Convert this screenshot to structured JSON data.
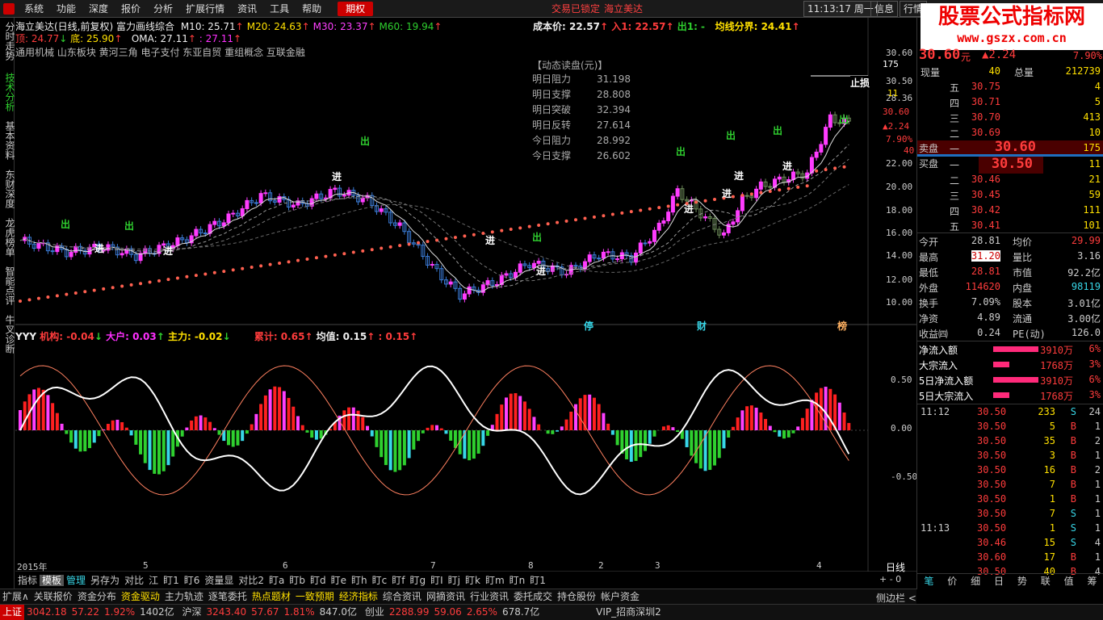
{
  "menubar": {
    "items": [
      "系统",
      "功能",
      "深度",
      "报价",
      "分析",
      "扩展行情",
      "资讯",
      "工具",
      "帮助"
    ],
    "active": "期权",
    "notice": "交易已锁定",
    "stock": "海立美达",
    "time": "11:13:17 周一",
    "info": "信息",
    "quote": "行情"
  },
  "watermark": {
    "title": "股票公式指标网",
    "url": "www.gszx.com.cn"
  },
  "sidebar": {
    "tabs": [
      "分时走势",
      "技术分析",
      "基本资料",
      "东财深度",
      "龙虎榜单",
      "智能点评",
      "牛叉诊断"
    ]
  },
  "chart": {
    "header1": "海立美达(日线,前复权) 富力画线综合",
    "ma": [
      {
        "label": "M10: 25.71",
        "arrow": "↑"
      },
      {
        "label": "M20: 24.63",
        "arrow": "↑"
      },
      {
        "label": "M30: 23.37",
        "arrow": "↑"
      },
      {
        "label": "M60: 19.94",
        "arrow": "↑"
      }
    ],
    "header2": {
      "top": "顶: 24.77",
      "top_arrow": "↓",
      "bottom": "底: 25.90",
      "bottom_arrow": "↑",
      "oma": "OMA: 27.11",
      "oma_arrow": "↑",
      "oma_val": ": 27.11",
      "oma_val_arrow": "↑"
    },
    "cost": {
      "cost": "成本价: 22.57",
      "cost_arrow": "↑",
      "in": "入1: 22.57",
      "in_arrow": "↑",
      "out": "出1: -",
      "line": "均线分界: 24.41",
      "line_arrow": "↑"
    },
    "concepts": "通用机械 山东板块 黄河三角 电子支付 东亚自贸 重组概念 互联金融",
    "dyn_title": "【动态读盘(元)】",
    "dyn": [
      {
        "k": "明日阻力",
        "v": "31.198"
      },
      {
        "k": "明日支撑",
        "v": "28.808"
      },
      {
        "k": "明日突破",
        "v": "32.394"
      },
      {
        "k": "明日反转",
        "v": "27.614"
      },
      {
        "k": "今日阻力",
        "v": "28.992"
      },
      {
        "k": "今日支撑",
        "v": "26.602"
      }
    ],
    "y_labels": [
      "30.60",
      "30.50",
      "28.36",
      "20.00",
      "22.00",
      "18.00",
      "16.00",
      "14.00",
      "12.00",
      "10.00"
    ],
    "right_labels": {
      "r1": "175",
      "r2": "11",
      "r3": "30.60",
      "r4": "▲2.24",
      "r5": "7.90%",
      "r6": "40",
      "stop": "止损"
    },
    "markers": {
      "in": "进",
      "out": "出",
      "ting": "停",
      "cai": "财",
      "bang": "榜",
      "s": "S"
    },
    "sub_header": {
      "name": "YYY",
      "jg": "机构: -0.04",
      "jg_arrow": "↓",
      "dh": "大户: 0.03",
      "dh_arrow": "↑",
      "zl": "主力: -0.02",
      "zl_arrow": "↓",
      "lj": "累计: 0.65",
      "lj_arrow": "↑",
      "jz": "均值: 0.15",
      "jz_arrow": "↑",
      "jz2": ": 0.15",
      "jz2_arrow": "↑"
    },
    "sub_y": [
      "0.50",
      "0.00",
      "-0.50"
    ],
    "x_labels": [
      "2015年",
      "5",
      "6",
      "7",
      "8",
      "2",
      "3",
      "4"
    ],
    "period": "日线",
    "zoom": "+ - 0",
    "tabs1": [
      "指标",
      "模板",
      "管理",
      "另存为",
      "对比",
      "江",
      "盯1",
      "盯6",
      "资量显",
      "对比2",
      "盯a",
      "盯b",
      "盯d",
      "盯e",
      "盯h",
      "盯c",
      "盯f",
      "盯g",
      "盯I",
      "盯j",
      "盯k",
      "盯m",
      "盯n",
      "盯1"
    ],
    "tabs2": [
      "扩展∧",
      "关联报价",
      "资金分布",
      "资金驱动",
      "主力轨迹",
      "逐笔委托",
      "热点题材",
      "一致预期",
      "经济指标",
      "综合资讯",
      "网摘资讯",
      "行业资讯",
      "委托成交",
      "持仓股份",
      "帐户资金"
    ],
    "tabs2_side": "侧边栏 <"
  },
  "quote": {
    "price": "30.60",
    "price_suffix": "元",
    "change": "▲2.24",
    "pct": "7.90%",
    "xianliang_label": "现量",
    "xianliang": "40",
    "zongliang_label": "总量",
    "zongliang": "212739",
    "sell": [
      {
        "lv": "五",
        "p": "30.75",
        "v": "4"
      },
      {
        "lv": "四",
        "p": "30.71",
        "v": "5"
      },
      {
        "lv": "三",
        "p": "30.70",
        "v": "413"
      },
      {
        "lv": "二",
        "p": "30.69",
        "v": "10"
      },
      {
        "lv": "一",
        "p": "30.60",
        "v": "175"
      }
    ],
    "buy": [
      {
        "lv": "一",
        "p": "30.50",
        "v": "11"
      },
      {
        "lv": "二",
        "p": "30.46",
        "v": "21"
      },
      {
        "lv": "三",
        "p": "30.45",
        "v": "59"
      },
      {
        "lv": "四",
        "p": "30.42",
        "v": "111"
      },
      {
        "lv": "五",
        "p": "30.41",
        "v": "101"
      }
    ],
    "sell_label": "卖盘",
    "buy_label": "买盘",
    "stats": [
      [
        "今开",
        "28.81",
        "均价",
        "29.99"
      ],
      [
        "最高",
        "31.20",
        "量比",
        "3.16"
      ],
      [
        "最低",
        "28.81",
        "市值",
        "92.2亿"
      ],
      [
        "外盘",
        "114620",
        "内盘",
        "98119"
      ],
      [
        "换手",
        "7.09%",
        "股本",
        "3.01亿"
      ],
      [
        "净资",
        "4.89",
        "流通",
        "3.00亿"
      ],
      [
        "收益㈣",
        "0.24",
        "PE(动)",
        "126.0"
      ]
    ],
    "flows": [
      {
        "k": "净流入额",
        "v": "3910万",
        "p": "6%"
      },
      {
        "k": "大宗流入",
        "v": "1768万",
        "p": "3%"
      },
      {
        "k": "5日净流入额",
        "v": "3910万",
        "p": "6%"
      },
      {
        "k": "5日大宗流入",
        "v": "1768万",
        "p": "3%"
      }
    ],
    "ticks": [
      {
        "t": "11:12",
        "p": "30.50",
        "v": "233",
        "s": "S",
        "n": "24"
      },
      {
        "t": "",
        "p": "30.50",
        "v": "5",
        "s": "B",
        "n": "1"
      },
      {
        "t": "",
        "p": "30.50",
        "v": "35",
        "s": "B",
        "n": "2"
      },
      {
        "t": "",
        "p": "30.50",
        "v": "3",
        "s": "B",
        "n": "1"
      },
      {
        "t": "",
        "p": "30.50",
        "v": "16",
        "s": "B",
        "n": "2"
      },
      {
        "t": "",
        "p": "30.50",
        "v": "7",
        "s": "B",
        "n": "1"
      },
      {
        "t": "",
        "p": "30.50",
        "v": "1",
        "s": "B",
        "n": "1"
      },
      {
        "t": "",
        "p": "30.50",
        "v": "7",
        "s": "S",
        "n": "1"
      },
      {
        "t": "11:13",
        "p": "30.50",
        "v": "1",
        "s": "S",
        "n": "1"
      },
      {
        "t": "",
        "p": "30.46",
        "v": "15",
        "s": "S",
        "n": "4"
      },
      {
        "t": "",
        "p": "30.60",
        "v": "17",
        "s": "B",
        "n": "1"
      },
      {
        "t": "",
        "p": "30.50",
        "v": "40",
        "s": "B",
        "n": "4"
      }
    ],
    "rtabs": [
      "笔",
      "价",
      "细",
      "日",
      "势",
      "联",
      "值",
      "筹"
    ]
  },
  "status": {
    "sh_label": "上证",
    "sh": "3042.18",
    "sh_chg": "57.22",
    "sh_pct": "1.92%",
    "sh_amt": "1402亿",
    "sz_label": "沪深",
    "sz": "3243.40",
    "sz_chg": "57.67",
    "sz_pct": "1.81%",
    "sz_amt": "847.0亿",
    "cy_label": "创业",
    "cy": "2288.99",
    "cy_chg": "59.06",
    "cy_pct": "2.65%",
    "cy_amt": "678.7亿",
    "vip": "VIP_招商深圳2"
  }
}
